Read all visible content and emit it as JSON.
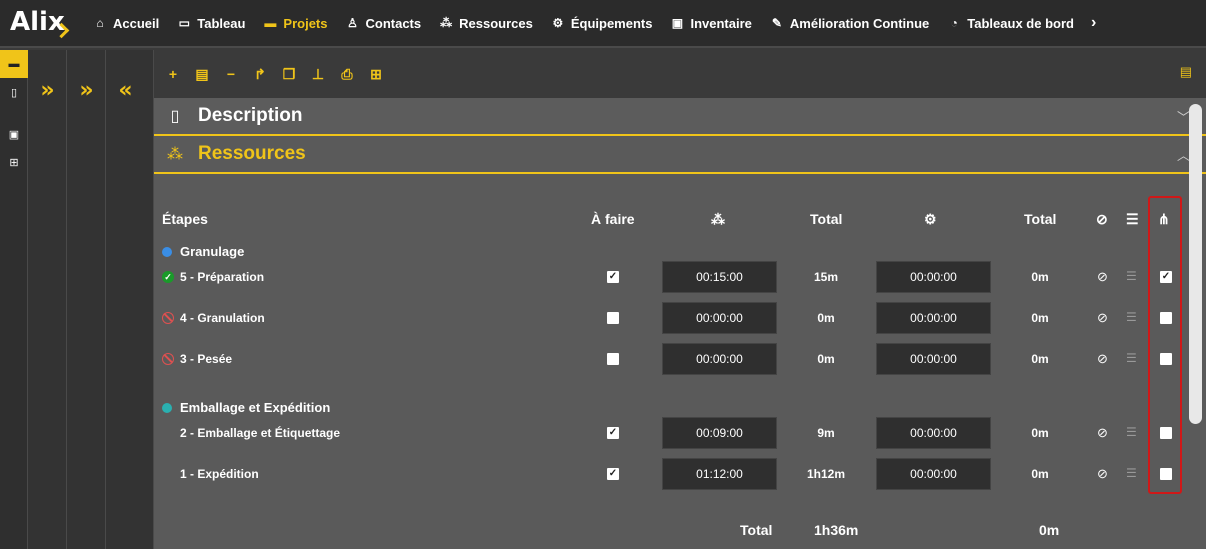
{
  "app": {
    "logo": "Alix"
  },
  "nav": {
    "items": [
      {
        "label": "Accueil",
        "icon": "home-icon",
        "glyph": "⌂"
      },
      {
        "label": "Tableau",
        "icon": "monitor-icon",
        "glyph": "▭"
      },
      {
        "label": "Projets",
        "icon": "folder-open-icon",
        "glyph": "▬",
        "active": true
      },
      {
        "label": "Contacts",
        "icon": "person-icon",
        "glyph": "♙"
      },
      {
        "label": "Ressources",
        "icon": "users-icon",
        "glyph": "⁂"
      },
      {
        "label": "Équipements",
        "icon": "cogs-icon",
        "glyph": "⚙"
      },
      {
        "label": "Inventaire",
        "icon": "boxes-icon",
        "glyph": "▣"
      },
      {
        "label": "Amélioration Continue",
        "icon": "magic-wand-icon",
        "glyph": "✎"
      },
      {
        "label": "Tableaux de bord",
        "icon": "gauge-icon",
        "glyph": "◔"
      }
    ],
    "more": "›"
  },
  "sections": {
    "description": "Description",
    "ressources": "Ressources"
  },
  "table": {
    "headers": {
      "etapes": "Étapes",
      "a_faire": "À faire",
      "total1": "Total",
      "total2": "Total"
    },
    "groups": [
      {
        "name": "Granulage",
        "color": "#3a8ee6",
        "steps": [
          {
            "label": "5 - Préparation",
            "status": "done",
            "a_faire": true,
            "time1": "00:15:00",
            "total1": "15m",
            "time2": "00:00:00",
            "total2": "0m",
            "linked": true
          },
          {
            "label": "4 - Granulation",
            "status": "blocked",
            "a_faire": false,
            "time1": "00:00:00",
            "total1": "0m",
            "time2": "00:00:00",
            "total2": "0m",
            "linked": false
          },
          {
            "label": "3 - Pesée",
            "status": "blocked",
            "a_faire": false,
            "time1": "00:00:00",
            "total1": "0m",
            "time2": "00:00:00",
            "total2": "0m",
            "linked": false
          }
        ]
      },
      {
        "name": "Emballage et Expédition",
        "color": "#2ab0b0",
        "steps": [
          {
            "label": "2 - Emballage et Étiquettage",
            "status": "none",
            "a_faire": true,
            "time1": "00:09:00",
            "total1": "9m",
            "time2": "00:00:00",
            "total2": "0m",
            "linked": false
          },
          {
            "label": "1 - Expédition",
            "status": "none",
            "a_faire": true,
            "time1": "01:12:00",
            "total1": "1h12m",
            "time2": "00:00:00",
            "total2": "0m",
            "linked": false
          }
        ]
      }
    ],
    "footer": {
      "label": "Total",
      "total1": "1h36m",
      "total2": "0m"
    }
  },
  "colors": {
    "accent": "#f0c419",
    "highlight": "#d01818"
  }
}
